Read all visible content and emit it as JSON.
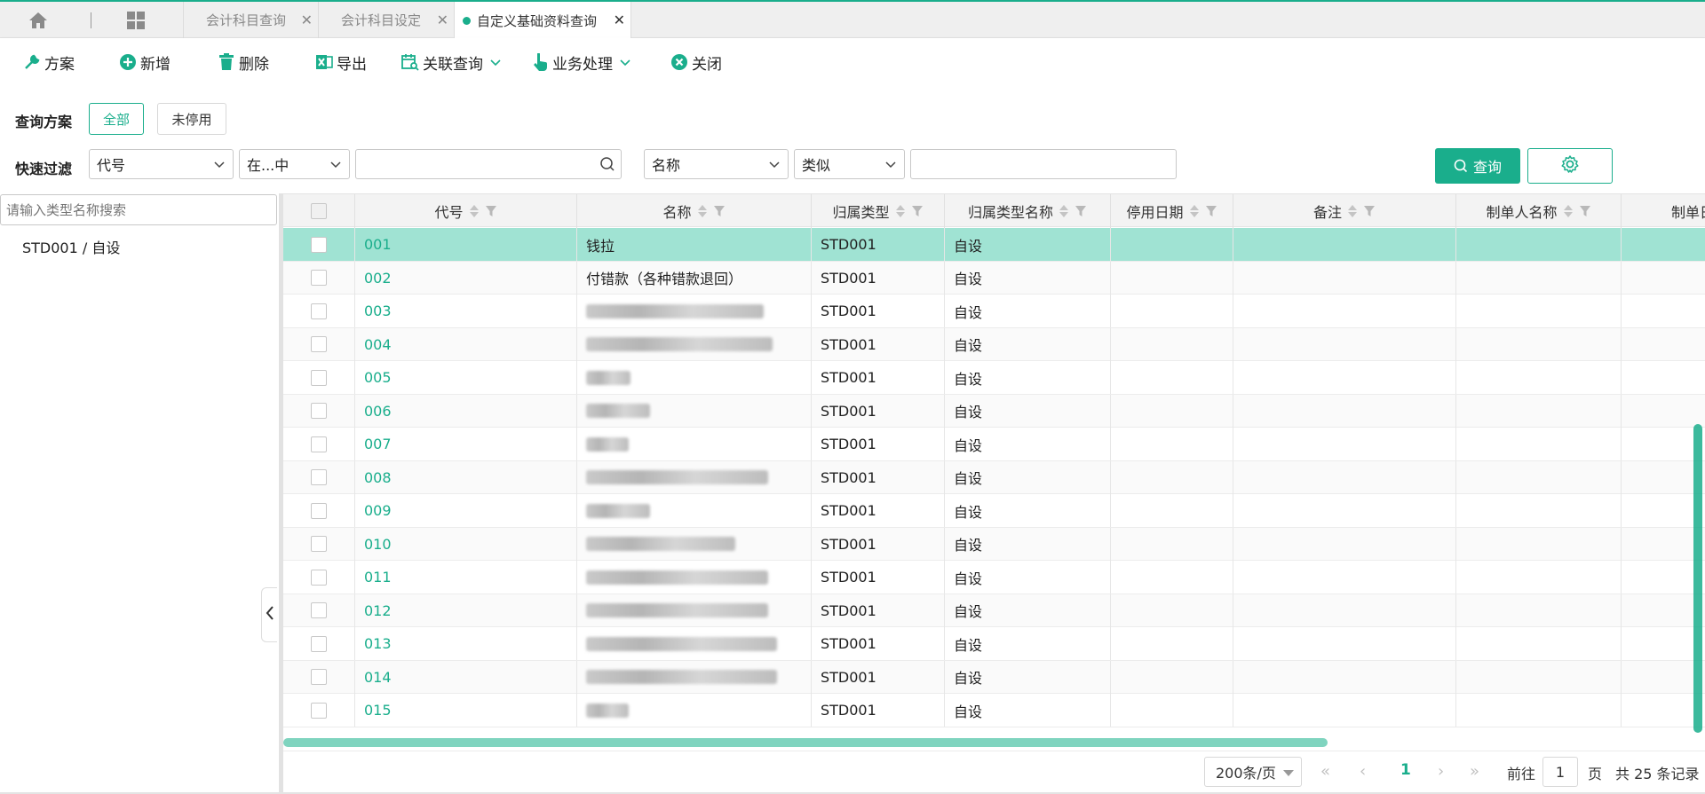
{
  "tabs": [
    {
      "label": "会计科目查询",
      "active": false
    },
    {
      "label": "会计科目设定",
      "active": false
    },
    {
      "label": "自定义基础资料查询",
      "active": true
    }
  ],
  "toolbar": {
    "plan": "方案",
    "add": "新增",
    "delete": "删除",
    "export": "导出",
    "related_query": "关联查询",
    "business": "业务处理",
    "close": "关闭"
  },
  "filters": {
    "scheme_label": "查询方案",
    "scheme_all": "全部",
    "scheme_enabled": "未停用",
    "quick_label": "快速过滤",
    "field1": "代号",
    "op1": "在...中",
    "value1": "",
    "field2": "名称",
    "op2": "类似",
    "value2": "",
    "query_button": "查询"
  },
  "left": {
    "search_placeholder": "请输入类型名称搜索",
    "tree_item": "STD001 / 自设"
  },
  "grid": {
    "columns": [
      "代号",
      "名称",
      "归属类型",
      "归属类型名称",
      "停用日期",
      "备注",
      "制单人名称",
      "制单日"
    ],
    "rows": [
      {
        "code": "001",
        "name": "钱拉",
        "type": "STD001",
        "type_name": "自设"
      },
      {
        "code": "002",
        "name": "付错款（各种错款退回）",
        "type": "STD001",
        "type_name": "自设"
      },
      {
        "code": "003",
        "name": "",
        "type": "STD001",
        "type_name": "自设"
      },
      {
        "code": "004",
        "name": "",
        "type": "STD001",
        "type_name": "自设"
      },
      {
        "code": "005",
        "name": "",
        "type": "STD001",
        "type_name": "自设"
      },
      {
        "code": "006",
        "name": "",
        "type": "STD001",
        "type_name": "自设"
      },
      {
        "code": "007",
        "name": "",
        "type": "STD001",
        "type_name": "自设"
      },
      {
        "code": "008",
        "name": "",
        "type": "STD001",
        "type_name": "自设"
      },
      {
        "code": "009",
        "name": "",
        "type": "STD001",
        "type_name": "自设"
      },
      {
        "code": "010",
        "name": "",
        "type": "STD001",
        "type_name": "自设"
      },
      {
        "code": "011",
        "name": "",
        "type": "STD001",
        "type_name": "自设"
      },
      {
        "code": "012",
        "name": "",
        "type": "STD001",
        "type_name": "自设"
      },
      {
        "code": "013",
        "name": "",
        "type": "STD001",
        "type_name": "自设"
      },
      {
        "code": "014",
        "name": "",
        "type": "STD001",
        "type_name": "自设"
      },
      {
        "code": "015",
        "name": "",
        "type": "STD001",
        "type_name": "自设"
      }
    ],
    "selected_row": 0
  },
  "pager": {
    "page_size": "200条/页",
    "current_page": "1",
    "goto_label": "前往",
    "goto_value": "1",
    "page_unit": "页",
    "total": "共 25 条记录"
  },
  "colors": {
    "accent": "#1aae8c",
    "selected_row": "#a0e3d3"
  }
}
